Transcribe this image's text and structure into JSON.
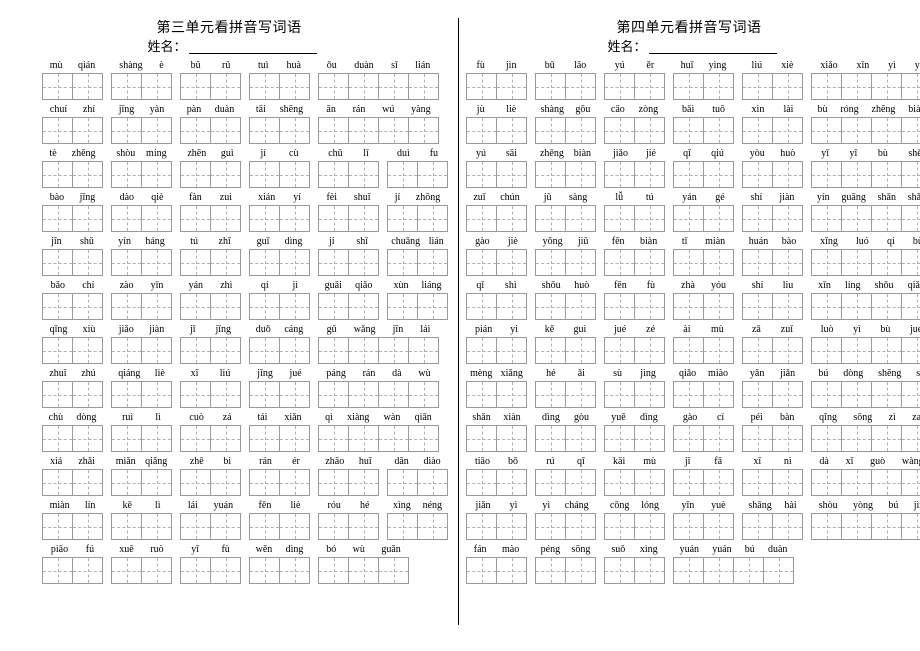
{
  "document": {
    "type": "pinyin-writing-worksheet",
    "ink_color": "#000000",
    "grid_border_color": "#9a9a9a",
    "grid_guide_color": "#b0b0b0"
  },
  "left": {
    "title": "第三单元看拼音写词语",
    "name_label": "姓名：",
    "rows": [
      [
        {
          "pinyin": [
            "mù",
            "qián"
          ]
        },
        {
          "pinyin": [
            "shàng",
            "è"
          ]
        },
        {
          "pinyin": [
            "bǔ",
            "rǔ"
          ]
        },
        {
          "pinyin": [
            "tuì",
            "huà"
          ]
        },
        {
          "pinyin": [
            "ǒu",
            "duàn",
            "sī",
            "lián"
          ]
        }
      ],
      [
        {
          "pinyin": [
            "chuí",
            "zhí"
          ]
        },
        {
          "pinyin": [
            "jīng",
            "yàn"
          ]
        },
        {
          "pinyin": [
            "pàn",
            "duàn"
          ]
        },
        {
          "pinyin": [
            "tāi",
            "shēng"
          ]
        },
        {
          "pinyin": [
            "ān",
            "rán",
            "wú",
            "yàng"
          ]
        }
      ],
      [
        {
          "pinyin": [
            "tè",
            "zhēng"
          ]
        },
        {
          "pinyin": [
            "shòu",
            "míng"
          ]
        },
        {
          "pinyin": [
            "zhēn",
            "guì"
          ]
        },
        {
          "pinyin": [
            "jí",
            "cù"
          ]
        },
        {
          "pinyin": [
            "chǔ",
            "lǐ"
          ]
        },
        {
          "pinyin": [
            "duì",
            "fu"
          ]
        }
      ],
      [
        {
          "pinyin": [
            "bào",
            "jǐng"
          ]
        },
        {
          "pinyin": [
            "dào",
            "qiè"
          ]
        },
        {
          "pinyin": [
            "fàn",
            "zuì"
          ]
        },
        {
          "pinyin": [
            "xián",
            "yí"
          ]
        },
        {
          "pinyin": [
            "fèi",
            "shuǐ"
          ]
        },
        {
          "pinyin": [
            "jí",
            "zhōng"
          ]
        }
      ],
      [
        {
          "pinyin": [
            "jīn",
            "shǔ"
          ]
        },
        {
          "pinyin": [
            "yín",
            "háng"
          ]
        },
        {
          "pinyin": [
            "tú",
            "zhī"
          ]
        },
        {
          "pinyin": [
            "guī",
            "dìng"
          ]
        },
        {
          "pinyin": [
            "jí",
            "shǐ"
          ]
        },
        {
          "pinyin": [
            "chuāng",
            "lián"
          ]
        }
      ],
      [
        {
          "pinyin": [
            "bǎo",
            "chí"
          ]
        },
        {
          "pinyin": [
            "zào",
            "yīn"
          ]
        },
        {
          "pinyin": [
            "yán",
            "zhì"
          ]
        },
        {
          "pinyin": [
            "qí",
            "jì"
          ]
        },
        {
          "pinyin": [
            "guāi",
            "qiǎo"
          ]
        },
        {
          "pinyin": [
            "xùn",
            "liáng"
          ]
        }
      ],
      [
        {
          "pinyin": [
            "qīng",
            "xiù"
          ]
        },
        {
          "pinyin": [
            "jiǎo",
            "jiàn"
          ]
        },
        {
          "pinyin": [
            "jī",
            "jǐng"
          ]
        },
        {
          "pinyin": [
            "duǒ",
            "cáng"
          ]
        },
        {
          "pinyin": [
            "gǔ",
            "wǎng",
            "jīn",
            "lái"
          ]
        }
      ],
      [
        {
          "pinyin": [
            "zhuī",
            "zhú"
          ]
        },
        {
          "pinyin": [
            "qiáng",
            "liè"
          ]
        },
        {
          "pinyin": [
            "xī",
            "liú"
          ]
        },
        {
          "pinyin": [
            "jǐng",
            "jué"
          ]
        },
        {
          "pinyin": [
            "páng",
            "rán",
            "dà",
            "wù"
          ]
        }
      ],
      [
        {
          "pinyin": [
            "chù",
            "dòng"
          ]
        },
        {
          "pinyin": [
            "ruì",
            "lì"
          ]
        },
        {
          "pinyin": [
            "cuò",
            "zá"
          ]
        },
        {
          "pinyin": [
            "tái",
            "xiǎn"
          ]
        },
        {
          "pinyin": [
            "qì",
            "xiàng",
            "wàn",
            "qiān"
          ]
        }
      ],
      [
        {
          "pinyin": [
            "xiá",
            "zhǎi"
          ]
        },
        {
          "pinyin": [
            "miǎn",
            "qiǎng"
          ]
        },
        {
          "pinyin": [
            "zhē",
            "bì"
          ]
        },
        {
          "pinyin": [
            "rán",
            "ér"
          ]
        },
        {
          "pinyin": [
            "zhāo",
            "huī"
          ]
        },
        {
          "pinyin": [
            "dān",
            "diào"
          ]
        }
      ],
      [
        {
          "pinyin": [
            "miàn",
            "lín"
          ]
        },
        {
          "pinyin": [
            "kē",
            "lì"
          ]
        },
        {
          "pinyin": [
            "lái",
            "yuán"
          ]
        },
        {
          "pinyin": [
            "fēn",
            "liè"
          ]
        },
        {
          "pinyin": [
            "róu",
            "hé"
          ]
        },
        {
          "pinyin": [
            "xìng",
            "néng"
          ]
        }
      ],
      [
        {
          "pinyin": [
            "piāo",
            "fú"
          ]
        },
        {
          "pinyin": [
            "xuē",
            "ruò"
          ]
        },
        {
          "pinyin": [
            "yī",
            "fù"
          ]
        },
        {
          "pinyin": [
            "wěn",
            "dìng"
          ]
        },
        {
          "pinyin": [
            "bó",
            "wù",
            "guǎn"
          ]
        }
      ]
    ]
  },
  "right": {
    "title": "第四单元看拼音写词语",
    "name_label": "姓名：",
    "rows": [
      [
        {
          "pinyin": [
            "fù",
            "jìn"
          ]
        },
        {
          "pinyin": [
            "bǔ",
            "lāo"
          ]
        },
        {
          "pinyin": [
            "yú",
            "ěr"
          ]
        },
        {
          "pinyin": [
            "huī",
            "yìng"
          ]
        },
        {
          "pinyin": [
            "liú",
            "xiè"
          ]
        },
        {
          "pinyin": [
            "xiǎo",
            "xīn",
            "yì",
            "yì"
          ]
        }
      ],
      [
        {
          "pinyin": [
            "jù",
            "liè"
          ]
        },
        {
          "pinyin": [
            "shàng",
            "gōu"
          ]
        },
        {
          "pinyin": [
            "cāo",
            "zòng"
          ]
        },
        {
          "pinyin": [
            "bǎi",
            "tuō"
          ]
        },
        {
          "pinyin": [
            "xìn",
            "lài"
          ]
        },
        {
          "pinyin": [
            "bù",
            "róng",
            "zhēng",
            "biàn"
          ]
        }
      ],
      [
        {
          "pinyin": [
            "yú",
            "sāi"
          ]
        },
        {
          "pinyin": [
            "zhēng",
            "biàn"
          ]
        },
        {
          "pinyin": [
            "jiǎo",
            "jié"
          ]
        },
        {
          "pinyin": [
            "qǐ",
            "qiú"
          ]
        },
        {
          "pinyin": [
            "yòu",
            "huò"
          ]
        },
        {
          "pinyin": [
            "yī",
            "yī",
            "bù",
            "shě"
          ]
        }
      ],
      [
        {
          "pinyin": [
            "zuǐ",
            "chún"
          ]
        },
        {
          "pinyin": [
            "jǔ",
            "sàng"
          ]
        },
        {
          "pinyin": [
            "lǚ",
            "tú"
          ]
        },
        {
          "pinyin": [
            "yán",
            "gé"
          ]
        },
        {
          "pinyin": [
            "shí",
            "jiàn"
          ]
        },
        {
          "pinyin": [
            "yín",
            "guāng",
            "shǎn",
            "shǎn"
          ]
        }
      ],
      [
        {
          "pinyin": [
            "gào",
            "jiè"
          ]
        },
        {
          "pinyin": [
            "yǒng",
            "jiǔ"
          ]
        },
        {
          "pinyin": [
            "fēn",
            "biàn"
          ]
        },
        {
          "pinyin": [
            "tǐ",
            "miàn"
          ]
        },
        {
          "pinyin": [
            "huán",
            "bào"
          ]
        },
        {
          "pinyin": [
            "xīng",
            "luó",
            "qí",
            "bù"
          ]
        }
      ],
      [
        {
          "pinyin": [
            "qǐ",
            "shì"
          ]
        },
        {
          "pinyin": [
            "shōu",
            "huò"
          ]
        },
        {
          "pinyin": [
            "fēn",
            "fù"
          ]
        },
        {
          "pinyin": [
            "zhà",
            "yóu"
          ]
        },
        {
          "pinyin": [
            "shí",
            "liu"
          ]
        },
        {
          "pinyin": [
            "xīn",
            "líng",
            "shǒu",
            "qiǎo"
          ]
        }
      ],
      [
        {
          "pinyin": [
            "pián",
            "yi"
          ]
        },
        {
          "pinyin": [
            "kě",
            "guì"
          ]
        },
        {
          "pinyin": [
            "jué",
            "zé"
          ]
        },
        {
          "pinyin": [
            "ài",
            "mù"
          ]
        },
        {
          "pinyin": [
            "zā",
            "zuǐ"
          ]
        },
        {
          "pinyin": [
            "luò",
            "yì",
            "bù",
            "jué"
          ]
        }
      ],
      [
        {
          "pinyin": [
            "mèng",
            "xiǎng"
          ]
        },
        {
          "pinyin": [
            "hé",
            "ǎi"
          ]
        },
        {
          "pinyin": [
            "sù",
            "jìng"
          ]
        },
        {
          "pinyin": [
            "qiǎo",
            "miào"
          ]
        },
        {
          "pinyin": [
            "yǎn",
            "jiǎn"
          ]
        },
        {
          "pinyin": [
            "bú",
            "dòng",
            "shēng",
            "sè"
          ]
        }
      ],
      [
        {
          "pinyin": [
            "shǎn",
            "xiàn"
          ]
        },
        {
          "pinyin": [
            "dìng",
            "gòu"
          ]
        },
        {
          "pinyin": [
            "yuē",
            "dìng"
          ]
        },
        {
          "pinyin": [
            "gào",
            "cí"
          ]
        },
        {
          "pinyin": [
            "péi",
            "bàn"
          ]
        },
        {
          "pinyin": [
            "qīng",
            "sōng",
            "zì",
            "zai"
          ]
        }
      ],
      [
        {
          "pinyin": [
            "tiāo",
            "bō"
          ]
        },
        {
          "pinyin": [
            "rú",
            "qī"
          ]
        },
        {
          "pinyin": [
            "kāi",
            "mù"
          ]
        },
        {
          "pinyin": [
            "jī",
            "fā"
          ]
        },
        {
          "pinyin": [
            "xī",
            "nì"
          ]
        },
        {
          "pinyin": [
            "dà",
            "xǐ",
            "guò",
            "wàng"
          ]
        }
      ],
      [
        {
          "pinyin": [
            "jiǎn",
            "yì"
          ]
        },
        {
          "pinyin": [
            "yì",
            "cháng"
          ]
        },
        {
          "pinyin": [
            "cōng",
            "lóng"
          ]
        },
        {
          "pinyin": [
            "yīn",
            "yuè"
          ]
        },
        {
          "pinyin": [
            "shāng",
            "hài"
          ]
        },
        {
          "pinyin": [
            "shòu",
            "yòng",
            "bú",
            "jìn"
          ]
        }
      ],
      [
        {
          "pinyin": [
            "fán",
            "mào"
          ]
        },
        {
          "pinyin": [
            "péng",
            "sōng"
          ]
        },
        {
          "pinyin": [
            "suǒ",
            "xìng"
          ]
        },
        {
          "pinyin": [
            "yuán",
            "yuán",
            "bú",
            "duàn"
          ]
        }
      ]
    ]
  }
}
